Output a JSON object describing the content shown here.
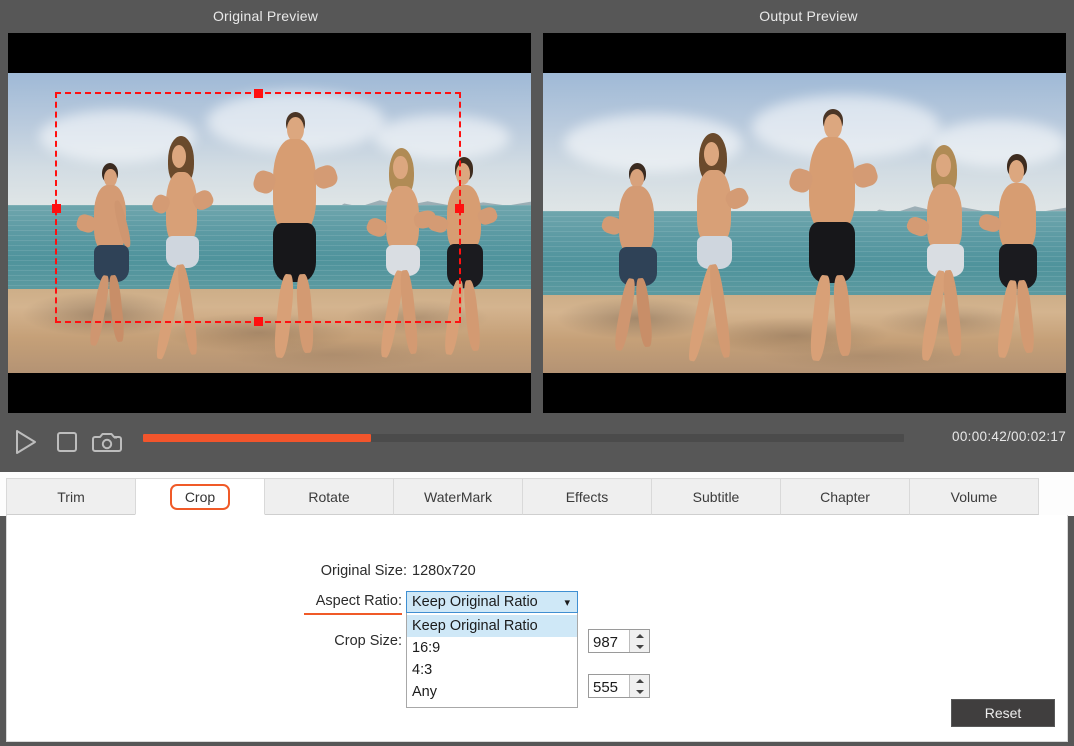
{
  "preview": {
    "original_title": "Original Preview",
    "output_title": "Output Preview"
  },
  "controls": {
    "play_icon": "play-icon",
    "stop_icon": "stop-icon",
    "snapshot_icon": "camera-icon",
    "timecode": "00:00:42/00:02:17",
    "progress_percent": 30,
    "progress_color": "#f2552c",
    "track_color": "#4b4b4b"
  },
  "tabs": [
    {
      "label": "Trim",
      "active": false
    },
    {
      "label": "Crop",
      "active": true
    },
    {
      "label": "Rotate",
      "active": false
    },
    {
      "label": "WaterMark",
      "active": false
    },
    {
      "label": "Effects",
      "active": false
    },
    {
      "label": "Subtitle",
      "active": false
    },
    {
      "label": "Chapter",
      "active": false
    },
    {
      "label": "Volume",
      "active": false
    }
  ],
  "crop_panel": {
    "original_size_label": "Original Size:",
    "original_size_value": "1280x720",
    "aspect_ratio_label": "Aspect Ratio:",
    "aspect_ratio_selected": "Keep Original Ratio",
    "aspect_ratio_options": [
      "Keep Original Ratio",
      "16:9",
      "4:3",
      "Any"
    ],
    "crop_size_label": "Crop Size:",
    "width_value": "987",
    "height_value": "555",
    "reset_label": "Reset",
    "accent_color": "#f05a28",
    "chevron_icon": "chevron-down-icon"
  },
  "crop_overlay": {
    "color": "#ff1010",
    "handle_icon": "resize-handle"
  }
}
